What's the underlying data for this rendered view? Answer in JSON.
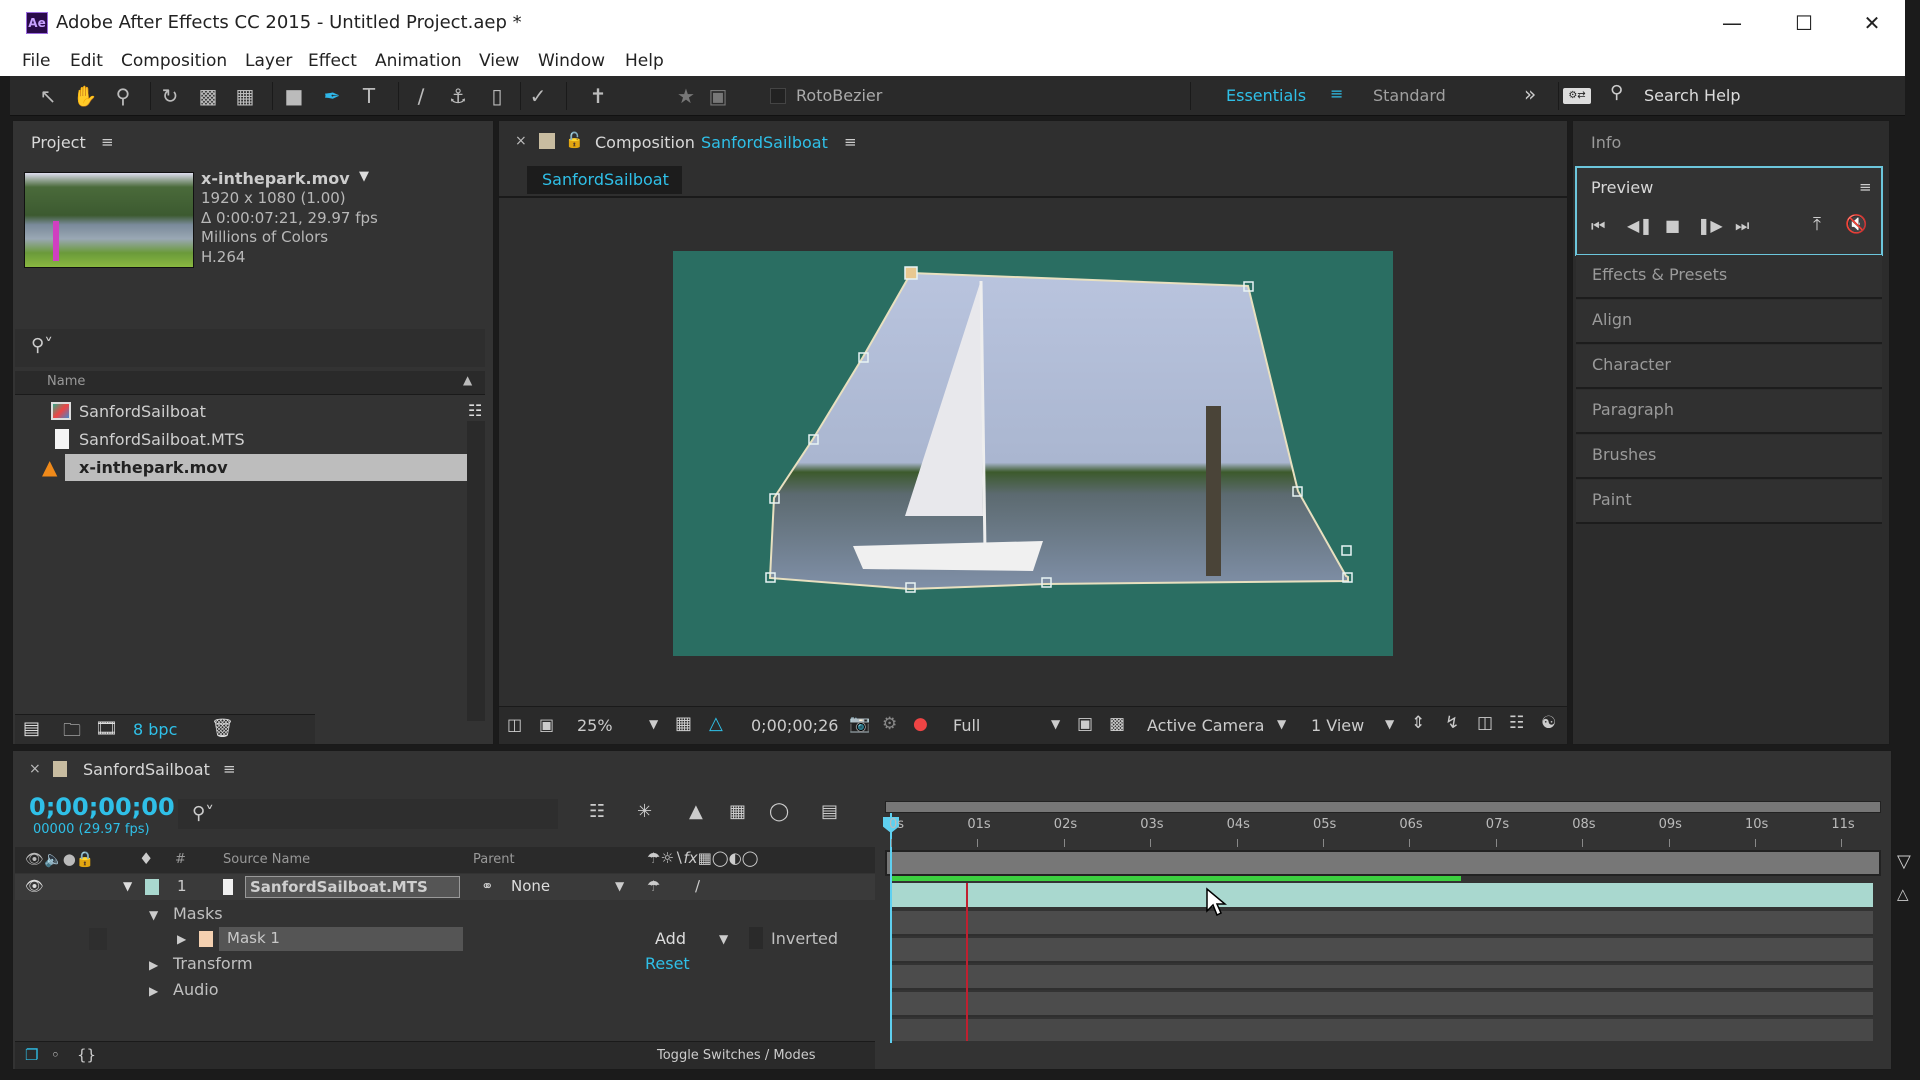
{
  "window": {
    "app_icon": "Ae",
    "title": "Adobe After Effects CC 2015 - Untitled Project.aep *",
    "controls": [
      "minimize-icon",
      "maximize-icon",
      "close-icon"
    ]
  },
  "menu": [
    "File",
    "Edit",
    "Composition",
    "Layer",
    "Effect",
    "Animation",
    "View",
    "Window",
    "Help"
  ],
  "toolbar": {
    "tools": [
      "selection-tool",
      "hand-tool",
      "zoom-tool",
      "rotate-tool",
      "camera-tool",
      "pan-behind-tool",
      "rectangle-tool",
      "pen-tool",
      "type-tool",
      "brush-tool",
      "clone-stamp-tool",
      "eraser-tool",
      "roto-brush-tool",
      "puppet-pin-tool"
    ],
    "active_tool": "pen-tool",
    "rotobezier_label": "RotoBezier",
    "rotobezier_checked": false,
    "workspace_active": "Essentials",
    "workspace_other": "Standard",
    "more": "»",
    "search_help": "Search Help"
  },
  "project": {
    "title": "Project",
    "selected_file": {
      "name": "x-inthepark.mov",
      "dimensions": "1920 x 1080 (1.00)",
      "duration": "Δ 0:00:07:21, 29.97 fps",
      "colors": "Millions of Colors",
      "codec": "H.264"
    },
    "search_placeholder": "",
    "column_name": "Name",
    "items": [
      {
        "name": "SanfordSailboat",
        "type": "composition"
      },
      {
        "name": "SanfordSailboat.MTS",
        "type": "footage"
      },
      {
        "name": "x-inthepark.mov",
        "type": "vlc-footage",
        "selected": true
      }
    ],
    "bpc": "8 bpc"
  },
  "composition": {
    "panel_label": "Composition",
    "name": "SanfordSailboat",
    "tab": "SanfordSailboat",
    "zoom": "25%",
    "timecode": "0;00;00;26",
    "resolution": "Full",
    "camera": "Active Camera",
    "views": "1 View",
    "bg_color": "#2a6e62"
  },
  "right_panels": {
    "info": "Info",
    "preview": "Preview",
    "preview_controls": [
      "first-frame",
      "prev-frame",
      "stop",
      "next-frame",
      "last-frame"
    ],
    "collapsed": [
      "Effects & Presets",
      "Align",
      "Character",
      "Paragraph",
      "Brushes",
      "Paint"
    ]
  },
  "timeline": {
    "comp_name": "SanfordSailboat",
    "current_time": "0;00;00;00",
    "frame_info": "00000 (29.97 fps)",
    "columns": {
      "num": "#",
      "source": "Source Name",
      "parent": "Parent"
    },
    "ruler": [
      "0s",
      "01s",
      "02s",
      "03s",
      "04s",
      "05s",
      "06s",
      "07s",
      "08s",
      "09s",
      "10s",
      "11s"
    ],
    "render_progress": 0.58,
    "layers": [
      {
        "index": "1",
        "name": "SanfordSailboat.MTS",
        "parent": "None",
        "label_color": "#a9d8cf"
      }
    ],
    "properties": {
      "masks": "Masks",
      "mask1": "Mask 1",
      "mask_mode": "Add",
      "inverted": "Inverted",
      "transform": "Transform",
      "reset": "Reset",
      "audio": "Audio"
    },
    "toggle": "Toggle Switches / Modes"
  }
}
